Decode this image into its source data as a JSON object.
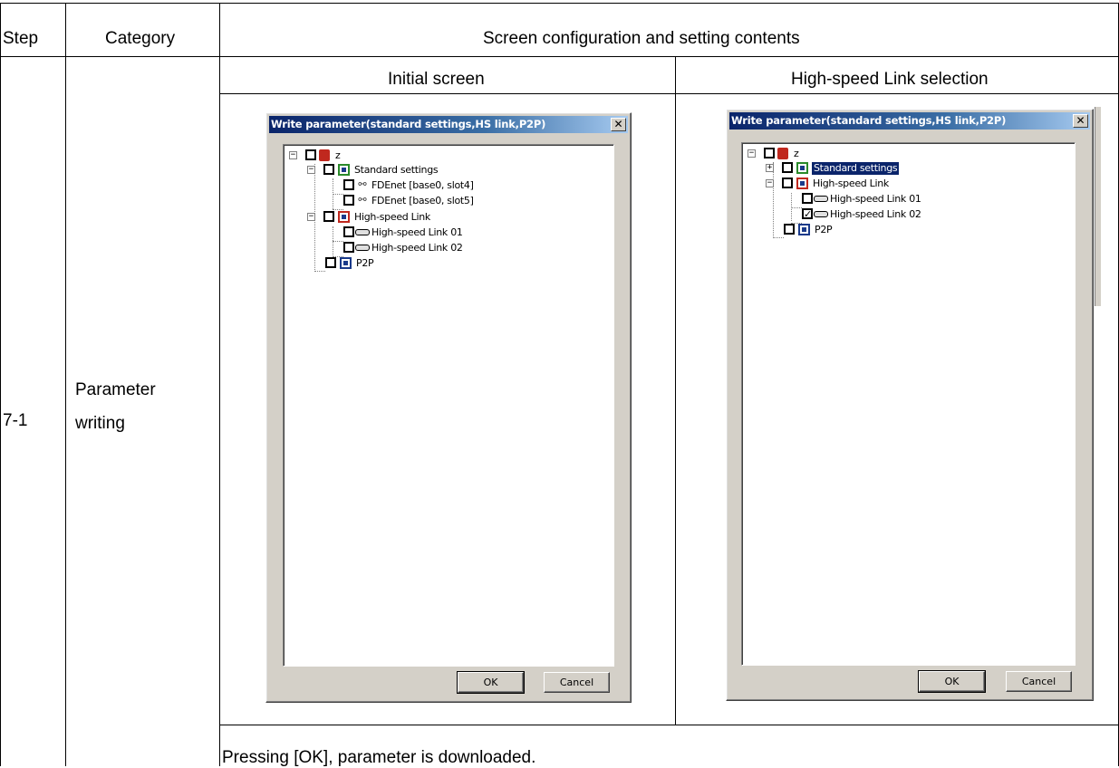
{
  "table": {
    "headers": {
      "step": "Step",
      "category": "Category",
      "content": "Screen configuration and setting contents"
    },
    "row": {
      "step": "7-1",
      "category_line1": "Parameter",
      "category_line2": "writing",
      "screen_left_title": "Initial screen",
      "screen_right_title": "High-speed Link selection",
      "note": "Pressing [OK], parameter is downloaded."
    }
  },
  "dialog_left": {
    "title": "Write parameter(standard settings,HS link,P2P)",
    "close_glyph": "✕",
    "tree": {
      "root": "z",
      "standard": "Standard settings",
      "fdenet4": "FDEnet [base0, slot4]",
      "fdenet5": "FDEnet [base0, slot5]",
      "hslink": "High-speed Link",
      "hs01": "High-speed Link 01",
      "hs02": "High-speed Link 02",
      "p2p": "P2P"
    },
    "ok_label": "OK",
    "cancel_label": "Cancel"
  },
  "dialog_right": {
    "title": "Write parameter(standard settings,HS link,P2P)",
    "close_glyph": "✕",
    "tree": {
      "root": "z",
      "standard": "Standard settings",
      "hslink": "High-speed Link",
      "hs01": "High-speed Link 01",
      "hs02": "High-speed Link 02",
      "p2p": "P2P",
      "hs02_checked": true
    },
    "ok_label": "OK",
    "cancel_label": "Cancel"
  },
  "glyphs": {
    "expanded": "−",
    "collapsed": "+",
    "check": "✓"
  }
}
